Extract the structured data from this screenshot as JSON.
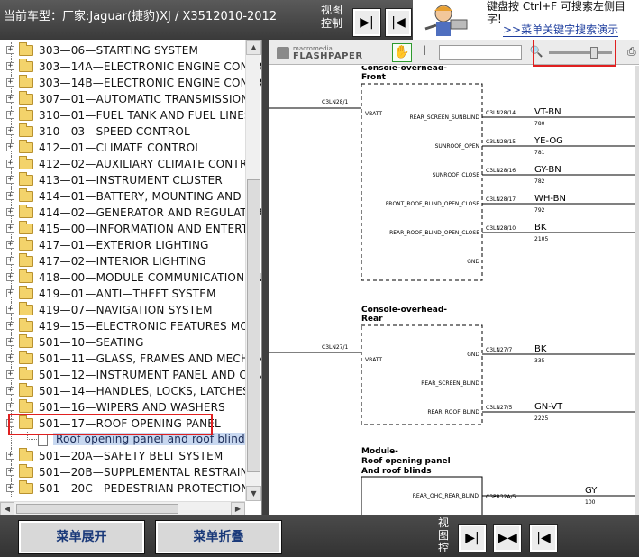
{
  "header": {
    "vehicle_title": "当前车型：厂家:Jaguar(捷豹)XJ / X3512010-2012",
    "view_control_label": "视图控制",
    "ad": {
      "text_line1": "键盘按       Ctrl+F  可搜索左侧目",
      "text_line2": "字!",
      "link": ">>菜单关键字搜索演示"
    }
  },
  "tree": {
    "items": [
      {
        "label": "303—06—STARTING SYSTEM"
      },
      {
        "label": "303—14A—ELECTRONIC ENGINE CONTR"
      },
      {
        "label": "303—14B—ELECTRONIC ENGINE CONTR"
      },
      {
        "label": "307—01—AUTOMATIC TRANSMISSION"
      },
      {
        "label": "310—01—FUEL TANK AND FUEL LINES"
      },
      {
        "label": "310—03—SPEED CONTROL"
      },
      {
        "label": "412—01—CLIMATE CONTROL"
      },
      {
        "label": "412—02—AUXILIARY CLIMATE CONTRO"
      },
      {
        "label": "413—01—INSTRUMENT CLUSTER"
      },
      {
        "label": "414—01—BATTERY, MOUNTING AND CA"
      },
      {
        "label": "414—02—GENERATOR AND REGULATOR"
      },
      {
        "label": "415—00—INFORMATION AND ENTERTAI"
      },
      {
        "label": "417—01—EXTERIOR LIGHTING"
      },
      {
        "label": "417—02—INTERIOR LIGHTING"
      },
      {
        "label": "418—00—MODULE COMMUNICATIONS N"
      },
      {
        "label": "419—01—ANTI—THEFT SYSTEM"
      },
      {
        "label": "419—07—NAVIGATION SYSTEM"
      },
      {
        "label": "419—15—ELECTRONIC FEATURES MOD"
      },
      {
        "label": "501—10—SEATING"
      },
      {
        "label": "501—11—GLASS, FRAMES AND MECHAN"
      },
      {
        "label": "501—12—INSTRUMENT PANEL AND CON"
      },
      {
        "label": "501—14—HANDLES, LOCKS, LATCHES A"
      },
      {
        "label": "501—16—WIPERS AND WASHERS"
      },
      {
        "label": "501—17—ROOF OPENING PANEL",
        "expanded": true
      },
      {
        "label": "Roof opening panel and roof blinds",
        "child": true,
        "selected": true
      },
      {
        "label": "501—20A—SAFETY BELT SYSTEM"
      },
      {
        "label": "501—20B—SUPPLEMENTAL RESTRAINT"
      },
      {
        "label": "501—20C—PEDESTRIAN PROTECTION S"
      }
    ]
  },
  "viewer": {
    "logo_small": "macromedia",
    "logo_big": "FLASHPAPER",
    "diagram": {
      "block1_title": "Console-overhead-",
      "block1_sub": "Front",
      "block2_title": "Console-overhead-",
      "block2_sub": "Rear",
      "block3_title": "Module-",
      "block3_line2": "Roof opening panel",
      "block3_line3": "And roof blinds",
      "front_in_connector": "C3LN28/1",
      "front_in_pin": "VBATT",
      "front_pins": [
        {
          "name": "REAR_SCREEN_SUNBLIND",
          "conn": "C3LN28/14",
          "wire": "VT-BN",
          "code": "780"
        },
        {
          "name": "SUNROOF_OPEN",
          "conn": "C3LN28/15",
          "wire": "YE-OG",
          "code": "781"
        },
        {
          "name": "SUNROOF_CLOSE",
          "conn": "C3LN28/16",
          "wire": "GY-BN",
          "code": "782"
        },
        {
          "name": "FRONT_ROOF_BLIND_OPEN_CLOSE",
          "conn": "C3LN28/17",
          "wire": "WH-BN",
          "code": "792"
        },
        {
          "name": "REAR_ROOF_BLIND_OPEN_CLOSE",
          "conn": "C3LN28/10",
          "wire": "BK",
          "code": "2105"
        },
        {
          "name": "GND",
          "conn": "",
          "wire": "",
          "code": ""
        }
      ],
      "rear_in_connector": "C3LN27/1",
      "rear_in_pin": "VBATT",
      "rear_pins": [
        {
          "name": "GND",
          "conn": "C3LN27/7",
          "wire": "BK",
          "code": "335"
        },
        {
          "name": "REAR_SCREEN_BLIND",
          "conn": "",
          "wire": "",
          "code": ""
        },
        {
          "name": "REAR_ROOF_BLIND",
          "conn": "C3LN27/5",
          "wire": "GN-VT",
          "code": "2225"
        }
      ],
      "module_pin": {
        "name": "REAR_OHC_REAR_BLIND",
        "conn": "C3PR32A/5",
        "wire": "GY",
        "code": "100"
      }
    }
  },
  "bottom": {
    "expand_label": "菜单展开",
    "collapse_label": "菜单折叠",
    "view_control_label": "视图控"
  },
  "colors": {
    "highlight": "#e02020",
    "button_text": "#1b3a7a",
    "selection_bg": "#c8d8f0"
  }
}
